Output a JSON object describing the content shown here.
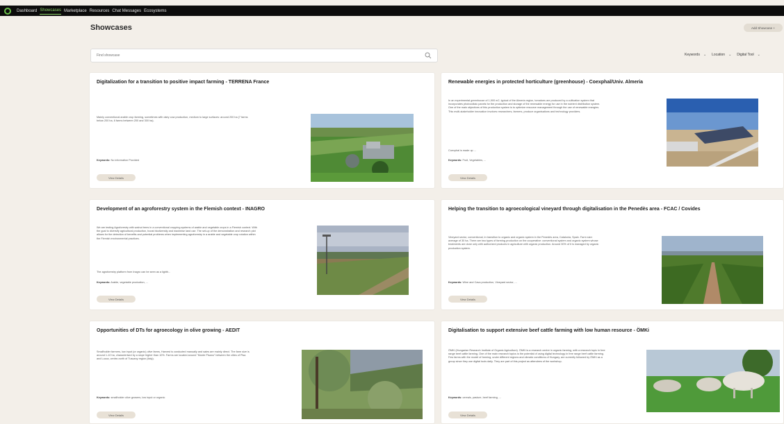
{
  "nav": {
    "items": [
      {
        "label": "Dashboard",
        "active": false
      },
      {
        "label": "Showcases",
        "active": true
      },
      {
        "label": "Marketplace",
        "active": false
      },
      {
        "label": "Resources",
        "active": false
      },
      {
        "label": "Chat Messages",
        "active": false
      },
      {
        "label": "Ecosystems",
        "active": false
      }
    ]
  },
  "page": {
    "title": "Showcases",
    "add_button": "Add Showcase +"
  },
  "search": {
    "placeholder": "Find showcase"
  },
  "filters": [
    {
      "label": "Keywords"
    },
    {
      "label": "Location"
    },
    {
      "label": "Digital Tool"
    }
  ],
  "cards": [
    {
      "title": "Digitalization for a transition to positive impact farming - TERRENA France",
      "description": "Mainly conventional arable crop farming, sometimes with dairy cow production, medium to large surfaces: around 200 ha (7 farms below 200 ha, 6 farms between 200 and 300 ha).",
      "extra": "",
      "keywords_label": "Keywords:",
      "keywords": "No information Provided",
      "button": "View Details",
      "image": "farm-aerial"
    },
    {
      "title": "Renewable energies in protected horticulture (greenhouse) - Coexphal/Univ. Almeria",
      "description": "In an experimental greenhouse of 1,900 m2, typical of the Almeria region, tomatoes are produced by a cultivation system that incorporates photovoltaic panels for the production and storage of the renewable energy for use in the nutrient distribution system. One of the main objectives of this production system is to optimize resource management through the use of renewable energies. This multi-stakeholder innovation involves researchers, farmers, produce organisations and technology providers.",
      "extra": "Coexphal is made up ...",
      "keywords_label": "Keywords:",
      "keywords": "Fruit, Vegetables, ...",
      "button": "View Details",
      "image": "solar-greenhouse"
    },
    {
      "title": "Development of an agroforestry system in the Flemish context - INAGRO",
      "description": "We are testing Agroforestry with walnut trees in a conventional cropping systems of arable and vegetable crops in a Flemish context. With the goal to diversify agricultural production, boost biodiversity and maximise land use. The set-up of the demonstration and research plot allows for the detection of benefits and potential problems when implementing agroforestry in a arable and vegetable crop rotation within the Flemish environmental practices.",
      "extra": "The agroforestry platform from Inagro can be seen as a lighth...",
      "keywords_label": "Keywords:",
      "keywords": "Arable, vegetable production, ...",
      "button": "View Details",
      "image": "agroforestry-field"
    },
    {
      "title": "Helping the transition to agroecological vineyard through digitalisation in the Penedès area - FCAC / Covides",
      "description": "Vineyard sector, conventional, in transition to organic and organic system in the Penedès area, Catalonia, Spain. Farm size: average of 30 ha. There are two types of farming production on the cooperative: conventional system and organic system whose treatments are done only with authorized products in agriculture with organic production. Around 30% of it is managed by organic production system.",
      "extra": "",
      "keywords_label": "Keywords:",
      "keywords": "Wine and Cava production, Vineyard sector, ...",
      "button": "View Details",
      "image": "vineyard"
    },
    {
      "title": "Opportunities of DTs for agroecology in olive growing - AEDIT",
      "description": "Smallholder farmers, low input (or organic) olive farms, Harvest is conducted manually and sales are mainly direct. The farm size is around 1-10 ha, characterised by a slope higher than 10%. Farms are located around \"Monte Pisano\" between the cities of Pisa and Lucca, centre-north of Tuscany region (Italy).",
      "extra": "",
      "keywords_label": "Keywords:",
      "keywords": "smallholder olive growers, low input or organic",
      "button": "View Details",
      "image": "olive-grove"
    },
    {
      "title": "Digitalisation to support extensive beef cattle farming with low human resource - ÖMKi",
      "description": "ÖMKi (Hungarian Research Institute of Organic Agriculture). ÖMKi is a research centre in organic farming, with a research topic in free range beef cattle farming. One of the main research topics is the potential of using digital technology in free range beef cattle farming. Few farms with the model of farming, under different regions and climatic conditions of Hungary, are currently followed by ÖMKi as a group since they use digital tools daily. They are part of this project as attendees of the workshop.",
      "extra": "",
      "keywords_label": "Keywords:",
      "keywords": "cereals, pasture, beef farming, ...",
      "button": "View Details",
      "image": "cattle-pasture"
    }
  ]
}
